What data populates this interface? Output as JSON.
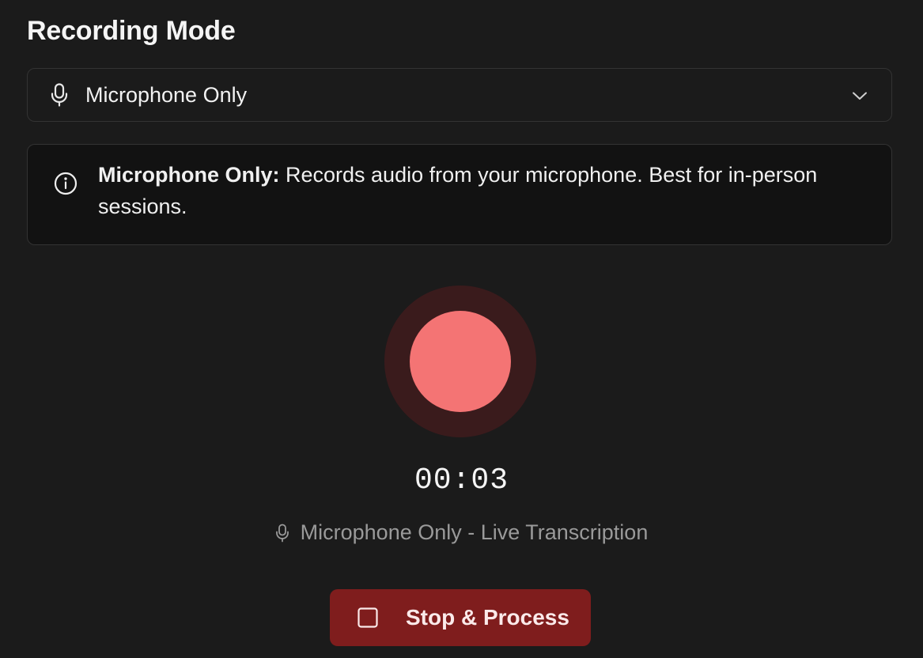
{
  "recording_mode": {
    "title": "Recording Mode",
    "select": {
      "icon": "microphone-icon",
      "value": "Microphone Only",
      "chevron_icon": "chevron-down-icon"
    },
    "info": {
      "icon": "info-icon",
      "label": "Microphone Only:",
      "description": " Records audio from your microphone. Best for in-person sessions."
    }
  },
  "recorder": {
    "state": "recording",
    "indicator_color": "#f47474",
    "indicator_halo_color": "#3a1b1c",
    "timer": "00:03",
    "status_icon": "microphone-icon",
    "status_text": "Microphone Only - Live Transcription"
  },
  "actions": {
    "stop_button": {
      "icon": "stop-square-icon",
      "label": "Stop & Process",
      "color": "#7f1d1d"
    }
  }
}
